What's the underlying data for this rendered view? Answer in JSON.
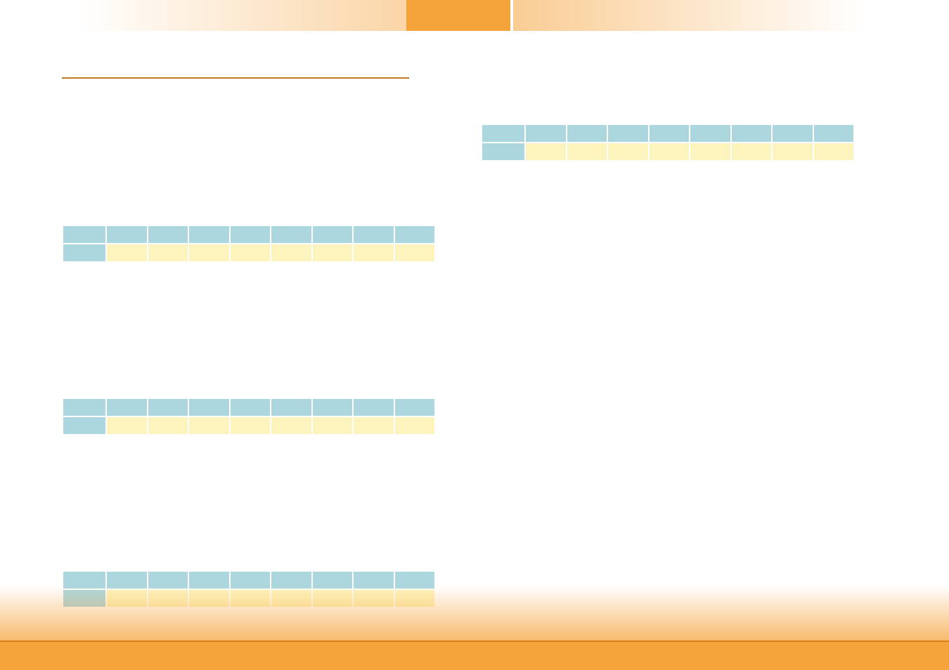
{
  "layout": {
    "accent_color": "#f5a33b",
    "rule_color": "#c07a24",
    "header_cell_color": "#acd7df",
    "data_cell_color": "#fdf4bd"
  },
  "left_column": {
    "has_divider": true,
    "tables": [
      {
        "id": "left-table-1",
        "cols": 9,
        "header_row": 1,
        "data_rows": 1
      },
      {
        "id": "left-table-2",
        "cols": 9,
        "header_row": 1,
        "data_rows": 1
      },
      {
        "id": "left-table-3",
        "cols": 9,
        "header_row": 1,
        "data_rows": 1
      }
    ]
  },
  "right_column": {
    "has_divider": false,
    "tables": [
      {
        "id": "right-table-1",
        "cols": 9,
        "header_row": 1,
        "data_rows": 1
      }
    ]
  }
}
